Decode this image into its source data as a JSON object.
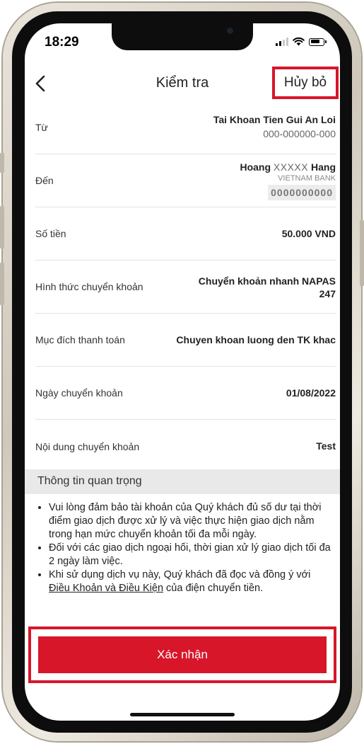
{
  "status_bar": {
    "time": "18:29"
  },
  "header": {
    "title": "Kiểm tra",
    "cancel_label": "Hủy bỏ"
  },
  "details": {
    "from": {
      "label": "Từ",
      "account_name": "Tai Khoan Tien Gui An Loi",
      "account_number": "000-000000-000"
    },
    "to": {
      "label": "Đến",
      "name_first": "Hoang ",
      "name_mask": "XXXXX",
      "name_last": " Hang",
      "bank": "VIETNAM BANK",
      "account_number": "0000000000"
    },
    "amount": {
      "label": "Số tiền",
      "value": "50.000 VND"
    },
    "method": {
      "label": "Hình thức chuyển khoản",
      "value_line1": "Chuyển khoản nhanh NAPAS",
      "value_line2": "247"
    },
    "purpose": {
      "label": "Mục đích thanh toán",
      "value": "Chuyen khoan luong den TK khac"
    },
    "date": {
      "label": "Ngày chuyển khoản",
      "value": "01/08/2022"
    },
    "content": {
      "label": "Nội dung chuyển khoản",
      "value": "Test"
    }
  },
  "important_info": {
    "title": "Thông tin quan trọng",
    "items": [
      "Vui lòng đảm bảo tài khoản của Quý khách đủ số dư tại thời điểm giao dịch được xử lý và việc thực hiện giao dịch nằm trong hạn mức chuyển khoản tối đa mỗi ngày.",
      "Đối với các giao dịch ngoại hối, thời gian xử lý giao dịch tối đa 2 ngày làm việc."
    ],
    "item3_prefix": "Khi sử dụng dịch vụ này, Quý khách đã đọc và đồng ý với ",
    "item3_link": "Điều Khoản và Điều Kiện",
    "item3_suffix": " của điện chuyển tiền."
  },
  "confirm": {
    "label": "Xác nhận"
  },
  "colors": {
    "accent": "#d7162a"
  }
}
